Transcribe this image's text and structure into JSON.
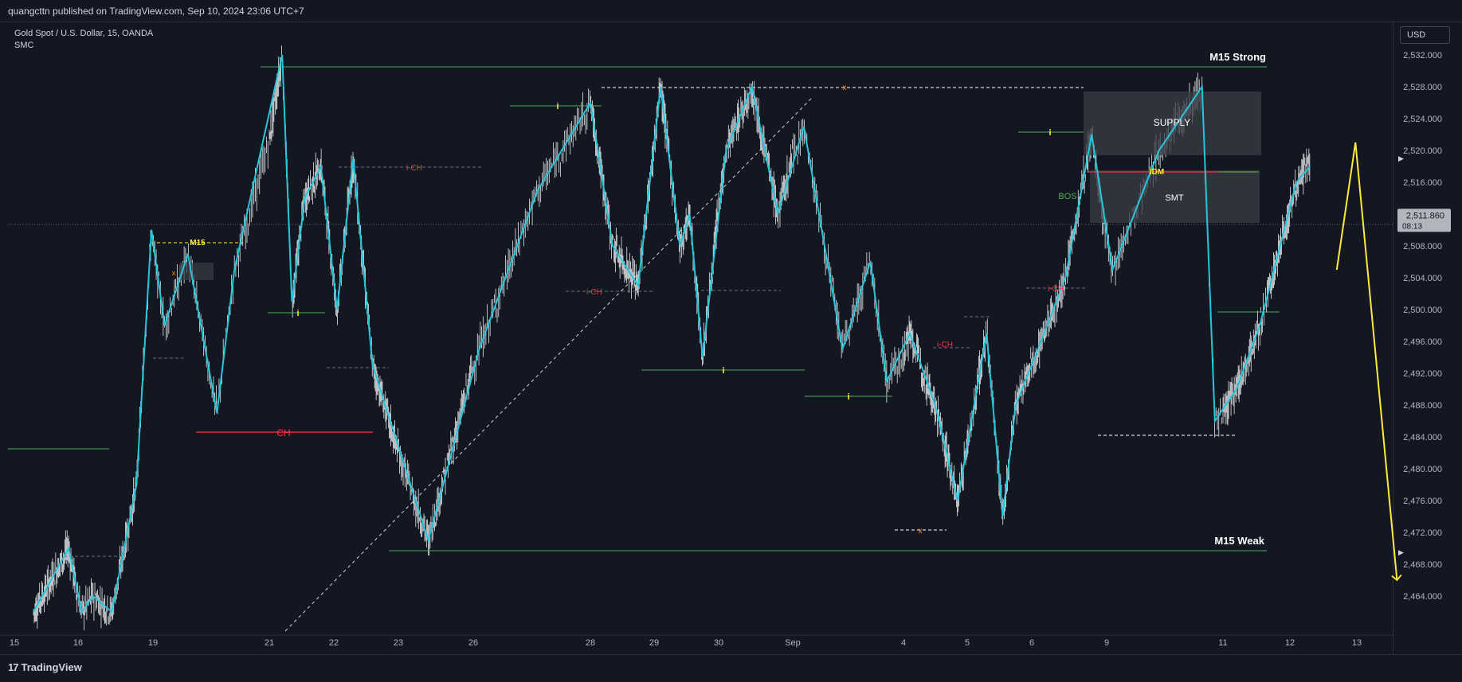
{
  "header": {
    "published_by": "quangcttn published on TradingView.com, Sep 10, 2024 23:06 UTC+7"
  },
  "symbol": {
    "title": "Gold Spot / U.S. Dollar, 15, OANDA",
    "indicator": "SMC"
  },
  "currency_button": "USD",
  "footer": {
    "logo_text": "TradingView",
    "logo_icon": "17"
  },
  "price_axis": {
    "ticks": [
      "2,532.000",
      "2,528.000",
      "2,524.000",
      "2,520.000",
      "2,516.000",
      "2,512.000",
      "2,508.000",
      "2,504.000",
      "2,500.000",
      "2,496.000",
      "2,492.000",
      "2,488.000",
      "2,484.000",
      "2,480.000",
      "2,476.000",
      "2,472.000",
      "2,468.000",
      "2,464.000"
    ],
    "current_price": "2,511.860",
    "countdown": "08:13"
  },
  "time_axis": {
    "labels": [
      "15",
      "16",
      "19",
      "21",
      "22",
      "23",
      "26",
      "28",
      "29",
      "30",
      "Sep",
      "4",
      "5",
      "6",
      "9",
      "11",
      "12",
      "13"
    ]
  },
  "annotations": {
    "m15_strong": "M15 Strong",
    "m15_weak": "M15 Weak",
    "supply": "SUPPLY",
    "smt": "SMT",
    "idm": "IDM",
    "bos": "BOS",
    "ch": "CH",
    "ich": "i-CH",
    "m15": "M15",
    "i_marker": "i",
    "x_marker": "x"
  },
  "colors": {
    "background": "#131722",
    "zigzag": "#26c6da",
    "candles": "#ffffff",
    "green_level": "#4caf50",
    "red_level": "#f23645",
    "yellow": "#ffeb3b",
    "zone": "#3a3d45"
  },
  "chart_data": {
    "type": "line",
    "instrument": "Gold Spot / U.S. Dollar",
    "timeframe": "15",
    "ylim": [
      2462,
      2534
    ],
    "x": [
      "15",
      "16",
      "19",
      "21",
      "22",
      "23",
      "26",
      "28",
      "29",
      "30",
      "Sep",
      "4",
      "5",
      "6",
      "9",
      "11",
      "12",
      "13"
    ],
    "series": [
      {
        "values": [
          [
            0.3,
            2462
          ],
          [
            0.85,
            2470
          ],
          [
            1.05,
            2462
          ],
          [
            1.2,
            2464
          ],
          [
            1.45,
            2462
          ],
          [
            1.78,
            2478
          ],
          [
            1.98,
            2510
          ],
          [
            2.1,
            2498
          ],
          [
            2.3,
            2507
          ],
          [
            2.55,
            2487
          ],
          [
            2.7,
            2505
          ],
          [
            3.2,
            2532
          ],
          [
            3.35,
            2501
          ],
          [
            3.55,
            2514
          ],
          [
            3.8,
            2518
          ],
          [
            4.05,
            2500
          ],
          [
            4.3,
            2519
          ],
          [
            4.6,
            2493
          ],
          [
            5.4,
            2471
          ],
          [
            6.05,
            2495
          ],
          [
            6.55,
            2515
          ],
          [
            7.0,
            2526
          ],
          [
            7.35,
            2508
          ],
          [
            7.75,
            2503
          ],
          [
            8.1,
            2528
          ],
          [
            8.4,
            2508
          ],
          [
            8.55,
            2512
          ],
          [
            8.75,
            2494
          ],
          [
            9.1,
            2520
          ],
          [
            9.45,
            2528
          ],
          [
            9.8,
            2512
          ],
          [
            10.1,
            2523
          ],
          [
            10.45,
            2495
          ],
          [
            10.7,
            2506
          ],
          [
            10.85,
            2491
          ],
          [
            11.1,
            2497
          ],
          [
            11.5,
            2488
          ],
          [
            11.85,
            2476
          ],
          [
            12.3,
            2497
          ],
          [
            12.55,
            2474
          ],
          [
            12.75,
            2488
          ],
          [
            13.0,
            2493
          ],
          [
            13.45,
            2504
          ],
          [
            13.8,
            2522
          ],
          [
            14.05,
            2505
          ],
          [
            14.45,
            2520
          ],
          [
            14.82,
            2528
          ],
          [
            14.93,
            2486
          ],
          [
            15.2,
            2490
          ],
          [
            15.55,
            2498
          ],
          [
            16.1,
            2516
          ],
          [
            16.3,
            2518
          ]
        ]
      }
    ],
    "projection": [
      [
        16.7,
        2505
      ],
      [
        16.98,
        2521
      ],
      [
        17.6,
        2466
      ]
    ],
    "levels": [
      {
        "label": "M15 Strong",
        "price": 2533
      },
      {
        "label": "M15 Weak",
        "price": 2471
      },
      {
        "label": "IDM",
        "price": 2519
      },
      {
        "label": "CH",
        "price": 2486
      },
      {
        "label": "M15",
        "price": 2510
      }
    ],
    "zones": [
      {
        "label": "SUPPLY",
        "top": 2529,
        "bottom": 2521
      },
      {
        "label": "SMT",
        "top": 2519,
        "bottom": 2512.5
      }
    ],
    "current_price": 2511.86
  }
}
